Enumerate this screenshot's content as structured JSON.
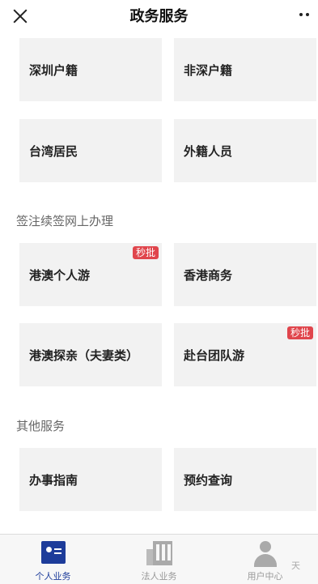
{
  "header": {
    "title": "政务服务"
  },
  "top_tiles": [
    {
      "label": "深圳户籍"
    },
    {
      "label": "非深户籍"
    },
    {
      "label": "台湾居民"
    },
    {
      "label": "外籍人员"
    }
  ],
  "section_visa": {
    "title": "签注续签网上办理",
    "tiles": [
      {
        "label": "港澳个人游",
        "badge": "秒批"
      },
      {
        "label": "香港商务"
      },
      {
        "label": "港澳探亲（夫妻类）"
      },
      {
        "label": "赴台团队游",
        "badge": "秒批"
      }
    ]
  },
  "section_other": {
    "title": "其他服务",
    "tiles": [
      {
        "label": "办事指南"
      },
      {
        "label": "预约查询"
      }
    ]
  },
  "tabbar": {
    "tabs": [
      {
        "label": "个人业务",
        "active": true
      },
      {
        "label": "法人业务"
      },
      {
        "label": "用户中心"
      }
    ]
  },
  "watermark": "天"
}
